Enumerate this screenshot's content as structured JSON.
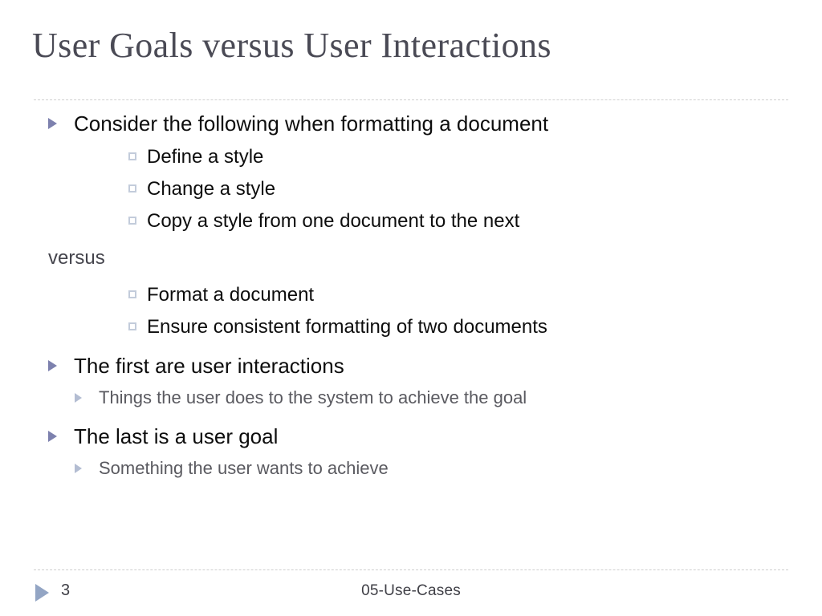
{
  "slide": {
    "title": "User Goals versus User Interactions",
    "content": [
      {
        "level": 1,
        "bullet": "triangle",
        "text": "Consider the following when formatting a document"
      },
      {
        "level": 2,
        "bullet": "square",
        "text": "Define a style"
      },
      {
        "level": 2,
        "bullet": "square",
        "text": "Change a style"
      },
      {
        "level": 2,
        "bullet": "square",
        "text": "Copy a style from one document to the next"
      },
      {
        "level": 0,
        "bullet": "none",
        "text": "versus"
      },
      {
        "level": 2,
        "bullet": "square",
        "text": "Format a document"
      },
      {
        "level": 2,
        "bullet": "square",
        "text": "Ensure consistent formatting of two documents"
      },
      {
        "level": 1,
        "bullet": "triangle",
        "text": "The first are user interactions"
      },
      {
        "level": 2,
        "bullet": "triangle-small",
        "text": "Things the user does to the system to achieve the goal"
      },
      {
        "level": 1,
        "bullet": "triangle",
        "text": "The last is a user goal"
      },
      {
        "level": 2,
        "bullet": "triangle-small",
        "text": "Something the user wants to achieve"
      }
    ],
    "footer": {
      "slide_number": "3",
      "deck_label": "05-Use-Cases"
    },
    "colors": {
      "title": "#4a4a55",
      "body_primary": "#0d0d0d",
      "body_secondary": "#5a5a60",
      "plain_text": "#44444c",
      "bullet_level1": "#7d81ae",
      "bullet_square_border": "#c3ccdb",
      "bullet_level2": "#b3bdd2",
      "footer_marker": "#93a5c4",
      "rule": "#cfcfcf",
      "background": "#ffffff"
    }
  }
}
